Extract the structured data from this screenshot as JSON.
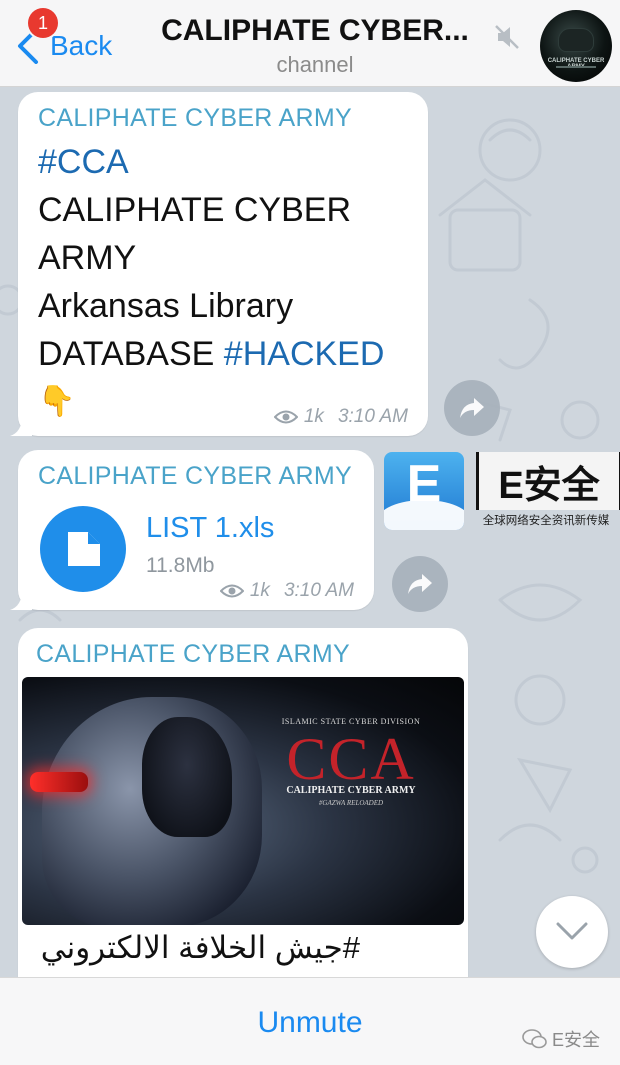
{
  "header": {
    "back_label": "Back",
    "badge_count": "1",
    "title": "CALIPHATE CYBER...",
    "subtitle": "channel",
    "avatar_caption": "CALIPHATE CYBER ARMY"
  },
  "messages": [
    {
      "sender": "CALIPHATE CYBER ARMY",
      "lines": {
        "l1": "#CCA",
        "l2": "CALIPHATE CYBER",
        "l3": "ARMY",
        "l4": "Arkansas Library",
        "l5a": "DATABASE ",
        "l5b": "#HACKED",
        "emoji": "👇"
      },
      "views": "1k",
      "time": "3:10 AM"
    },
    {
      "sender": "CALIPHATE CYBER ARMY",
      "file_name": "LIST 1.xls",
      "file_size": "11.8Mb",
      "views": "1k",
      "time": "3:10 AM"
    },
    {
      "sender": "CALIPHATE CYBER ARMY",
      "image": {
        "top_text": "ISLAMIC STATE CYBER DIVISION",
        "big_text": "CCA",
        "sub_text": "CALIPHATE CYBER ARMY",
        "sub_text2": "#GAZWA RELOADED"
      },
      "arabic_text": "#جيش الخلافة الالكتروني"
    }
  ],
  "watermark": {
    "logo_letter": "E",
    "brand": "E安全",
    "slogan": "全球网络安全资讯新传媒",
    "footer": "E安全"
  },
  "bottom": {
    "action_label": "Unmute"
  },
  "colors": {
    "accent": "#1a8af0",
    "sender": "#4aa3c9",
    "hashtag": "#1c6ab1",
    "badge": "#e8392f",
    "file_icon": "#1f8eea"
  },
  "icons": [
    "chevron-left-icon",
    "mute-icon",
    "eye-icon",
    "share-icon",
    "document-icon",
    "chevron-down-icon",
    "wechat-icon"
  ]
}
